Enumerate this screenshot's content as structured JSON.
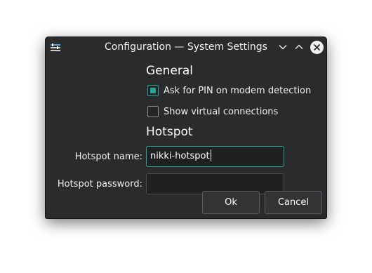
{
  "window": {
    "title": "Configuration — System Settings"
  },
  "general": {
    "heading": "General",
    "ask_pin": {
      "label": "Ask for PIN on modem detection",
      "checked": true
    },
    "show_virtual": {
      "label": "Show virtual connections",
      "checked": false
    }
  },
  "hotspot": {
    "heading": "Hotspot",
    "name_label": "Hotspot name:",
    "name_value": "nikki-hotspot",
    "password_label": "Hotspot password:",
    "password_value": ""
  },
  "buttons": {
    "ok": "Ok",
    "cancel": "Cancel"
  },
  "colors": {
    "accent": "#2aa59a",
    "window_bg": "#2a2b2d",
    "text": "#fcfcfc"
  },
  "icons": {
    "app": "settings-sliders-icon",
    "minimize": "chevron-down-icon",
    "maximize": "chevron-up-icon",
    "close": "close-icon"
  }
}
